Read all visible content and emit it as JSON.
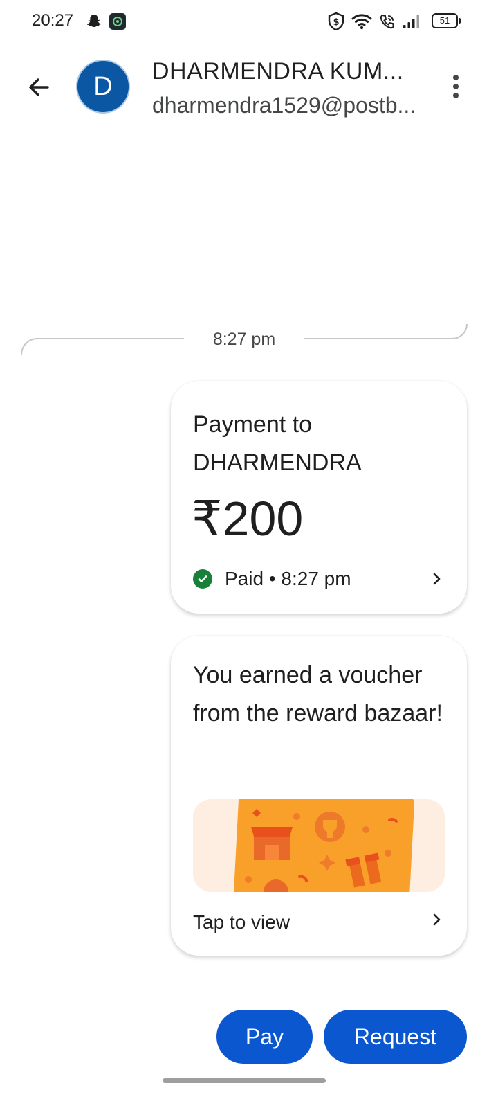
{
  "status_bar": {
    "time": "20:27",
    "battery": "51",
    "icons": [
      "snapchat-icon",
      "app-icon",
      "vpn-shield-icon",
      "wifi-icon",
      "wifi-calling-icon",
      "signal-icon",
      "battery-icon"
    ]
  },
  "header": {
    "avatar_letter": "D",
    "contact_name": "DHARMENDRA KUM...",
    "contact_id": "dharmendra1529@postb...",
    "avatar_color": "#0b57a4"
  },
  "conversation": {
    "timestamp": "8:27 pm",
    "payment_card": {
      "title": "Payment to DHARMENDRA",
      "amount": "₹200",
      "status": "Paid • 8:27 pm",
      "status_color": "#188038"
    },
    "reward_card": {
      "title": "You earned a voucher from the reward bazaar!",
      "action": "Tap to view"
    }
  },
  "actions": {
    "pay_label": "Pay",
    "request_label": "Request",
    "accent_color": "#0b57d0"
  }
}
